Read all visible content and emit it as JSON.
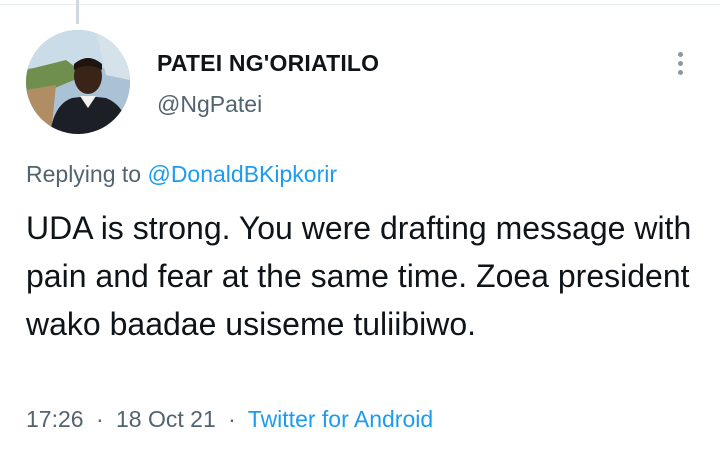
{
  "tweet": {
    "author_name": "PATEI NG'ORIATILO",
    "author_handle": "@NgPatei",
    "replying_label": "Replying to",
    "replying_to": "@DonaldBKipkorir",
    "text": "UDA is strong. You were drafting message with pain and fear at the same time. Zoea president wako baadae usiseme tuliibiwo.",
    "time": "17:26",
    "separator": "·",
    "date": "18 Oct 21",
    "source": "Twitter for Android"
  },
  "icons": {
    "more": "more-vertical-icon"
  },
  "colors": {
    "link": "#1d9bf0",
    "secondary_text": "#536471",
    "primary_text": "#0f1419"
  }
}
